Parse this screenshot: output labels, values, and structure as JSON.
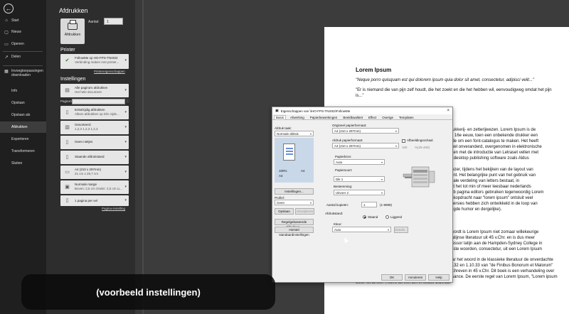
{
  "nav": {
    "items": [
      {
        "icon": "home-icon",
        "label": "Start"
      },
      {
        "icon": "new-document-icon",
        "label": "Nieuw"
      },
      {
        "icon": "folder-icon",
        "label": "Openen"
      },
      {
        "icon": "share-icon",
        "label": "Delen"
      },
      {
        "icon": "addin-icon",
        "label": "Invoegtoepassingen downloaden"
      },
      {
        "icon": "",
        "label": "Info"
      },
      {
        "icon": "",
        "label": "Opslaan"
      },
      {
        "icon": "",
        "label": "Opslaan als"
      },
      {
        "icon": "",
        "label": "Afdrukken"
      },
      {
        "icon": "",
        "label": "Exporteren"
      },
      {
        "icon": "",
        "label": "Transformeren"
      },
      {
        "icon": "",
        "label": "Sluiten"
      }
    ]
  },
  "print": {
    "title": "Afdrukken",
    "button_label": "Afdrukken",
    "copies_label": "Aantal:",
    "copies_value": "1",
    "printer_section": "Printer",
    "printer_name": "FollowMe op HO-FPS-TNIS02",
    "printer_status": "Verbinding maken met printer...",
    "printer_props_link": "Printereigenschappen",
    "settings_section": "Instellingen",
    "pages_label": "Pagina's:",
    "page_setup_link": "Pagina-instelling",
    "options": [
      {
        "icon": "pages-icon",
        "line1": "Alle pagina's afdrukken",
        "line2": "Het hele document"
      },
      {
        "icon": "single-sided-icon",
        "line1": "Enkelzijdig afdrukken",
        "line2": "Alleen afdrukken op één zijde..."
      },
      {
        "icon": "collate-icon",
        "line1": "Gesorteerd",
        "line2": "1,2,3   1,2,3   1,2,3"
      },
      {
        "icon": "staple-icon",
        "line1": "Geen nietjes",
        "line2": ""
      },
      {
        "icon": "portrait-icon",
        "line1": "Staande afdrukstand",
        "line2": ""
      },
      {
        "icon": "paper-size-icon",
        "line1": "A4 (210 x 297mm)",
        "line2": "21 cm x 29,7 cm"
      },
      {
        "icon": "margins-icon",
        "line1": "Normale marge",
        "line2": "Boven: 2,5 cm Onder: 2,5 cm Li..."
      },
      {
        "icon": "pages-per-sheet-icon",
        "line1": "1 pagina per vel",
        "line2": ""
      }
    ]
  },
  "document": {
    "title": "Lorem Ipsum",
    "quote": "\"Neque porro quisquam est qui dolorem ipsum quia dolor sit amet, consectetur, adipisci velit...\"",
    "intro": "\"Er is niemand die van pijn zelf houdt, die het zoekt en die het hebben wil, eenvoudigweg omdat het pijn is...\"",
    "side_lines": [
      "rukkerij- en zetterijwezen. Lorem Ipsum is de",
      "e 16e eeuw, toen een onbekende drukker een",
      "ide om een font-catalogus te maken. Het heeft",
      "wel onveranderd, overgenomen in elektronische",
      "den met de introductie van Letraset vellen met",
      "r desktop publishing software zoals Aldus",
      "",
      "lezer, tijdens het bekijken van de layout van",
      "ent. Het belangrijke punt van het gebruik van",
      "nale verdeling van letters bestaat, in",
      "at het tot min of meer leesbaar nederlands",
      "ub pagina editors gebruiken tegenwoordig Lorem",
      "ekopdracht naar \"lorem ipsum\" ontsluit veel",
      "versies hebben zich ontwikkeld in de loop van",
      "ngde humor en dergelijke).",
      "",
      "",
      "",
      "wordt is Lorem Ipsum niet zomaar willekeurige",
      "latijnse literatuur uit 45 v.Chr. en is dus meer",
      "fessor latijn aan de Hampden-Sydney College in",
      "dste woorden, consectetur, uit een Lorem Ipsum"
    ],
    "bottom_text": "passage opgezocht, en heeft tijdens het zoeken naar het woord in de klassieke literatuur de onverdachte bron ontdekt. Lorem Ipsum komt uit de secties 1.10.32 en 1.10.33 van \"de Finibus Bonorum et Malorum\" (De uitersten van goed en kwaad) door Cicero, geschreven in 45 v.Chr. Dit boek is een verhandeling over de theorie der ethiek, erg populair tijdens de renaissance. De eerste regel van Lorem Ipsum, \"Lorem ipsum dolor sit amet..\", komt uit een zin in sectie 1.10.32."
  },
  "dialog": {
    "title": "Eigenschappen van \\\\HO-FPS-TNIS02\\FollowMe",
    "close": "×",
    "tabs": [
      "Basis",
      "Afwerking",
      "Papierbewerkingen",
      "Beeldkwaliteit",
      "Effect",
      "Overige",
      "Templates"
    ],
    "task_label": "Afdruk taak:",
    "task_value": "Normale afdruk",
    "preview_zoom": "100%",
    "preview_size_a": "A4",
    "preview_size_b": "A4",
    "settings_button": "Instellingen...",
    "profile_label": "Profiel:",
    "profile_value": "Geen",
    "save_button": "Opslaan",
    "load_button": "Verwijderen",
    "recent_button": "Regelgebaseerde afdrukken...",
    "reset_button": "Herstel standaardinstellingen",
    "orig_size_label": "Origineel papierformaat:",
    "orig_size_value": "A4 (210 x 297mm)",
    "out_size_label": "Afdruk papierformaat:",
    "out_size_value": "A4 (210 x 297mm)",
    "zoom_check_label": "Afbeeldingsschaal",
    "zoom_value": "100",
    "zoom_range": "%(25-400)",
    "tray_label": "Papierbron:",
    "tray_value": "Auto",
    "type_label": "Papiersoort:",
    "type_value": "Dik 1",
    "dest_label": "Bestemming:",
    "dest_value": "Uitvoer 2",
    "copies_label": "Aantal kopieën:",
    "copies_value": "1",
    "copies_range": "(1-9999)",
    "orient_label": "Afdrukstand:",
    "orient_portrait": "Staand",
    "orient_landscape": "Liggend",
    "color_label": "Kleur:",
    "color_value": "Auto",
    "color_details_button": "Details...",
    "ok_button": "OK",
    "cancel_button": "Annuleren",
    "help_button": "Help"
  },
  "caption": "(voorbeeld instellingen)"
}
